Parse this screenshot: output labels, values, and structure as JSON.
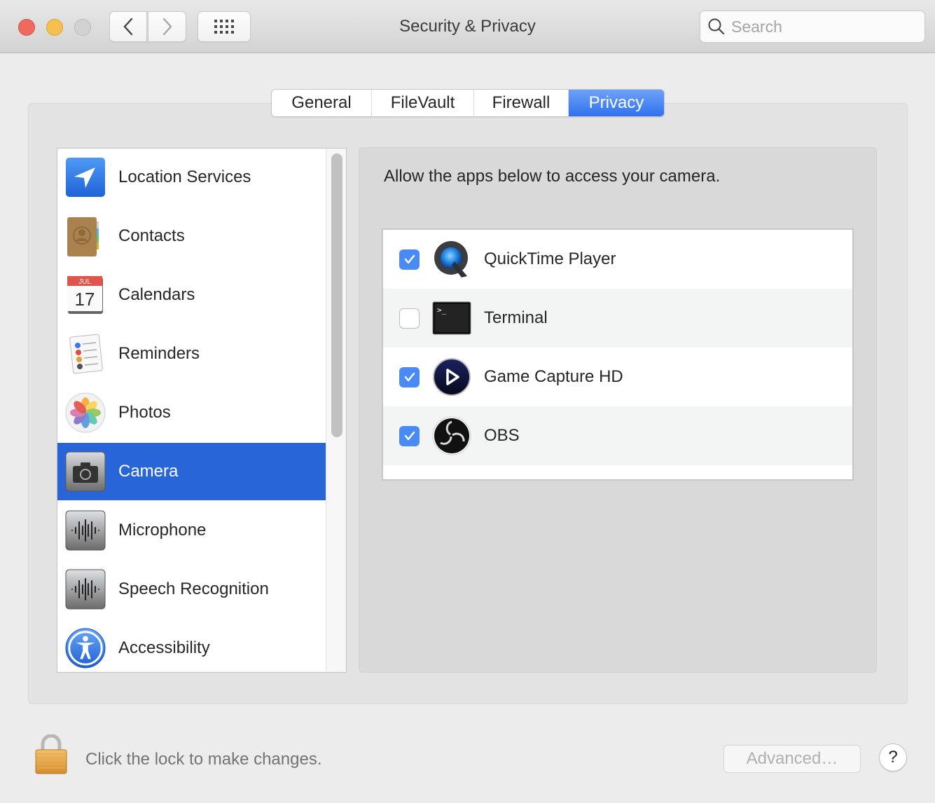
{
  "window": {
    "title": "Security & Privacy",
    "search": {
      "placeholder": "Search",
      "value": ""
    }
  },
  "tabs": [
    {
      "label": "General",
      "active": false
    },
    {
      "label": "FileVault",
      "active": false
    },
    {
      "label": "Firewall",
      "active": false
    },
    {
      "label": "Privacy",
      "active": true
    }
  ],
  "categories": [
    {
      "label": "Location Services",
      "icon": "location-icon",
      "selected": false
    },
    {
      "label": "Contacts",
      "icon": "contacts-icon",
      "selected": false
    },
    {
      "label": "Calendars",
      "icon": "calendar-icon",
      "selected": false,
      "icon_month": "JUL",
      "icon_day": "17"
    },
    {
      "label": "Reminders",
      "icon": "reminders-icon",
      "selected": false
    },
    {
      "label": "Photos",
      "icon": "photos-icon",
      "selected": false
    },
    {
      "label": "Camera",
      "icon": "camera-icon",
      "selected": true
    },
    {
      "label": "Microphone",
      "icon": "microphone-icon",
      "selected": false
    },
    {
      "label": "Speech Recognition",
      "icon": "speech-recognition-icon",
      "selected": false
    },
    {
      "label": "Accessibility",
      "icon": "accessibility-icon",
      "selected": false
    }
  ],
  "panel": {
    "instruction": "Allow the apps below to access your camera.",
    "apps": [
      {
        "label": "QuickTime Player",
        "icon": "quicktime-icon",
        "checked": true
      },
      {
        "label": "Terminal",
        "icon": "terminal-icon",
        "checked": false,
        "icon_text": ">_"
      },
      {
        "label": "Game Capture HD",
        "icon": "game-capture-icon",
        "checked": true
      },
      {
        "label": "OBS",
        "icon": "obs-icon",
        "checked": true
      }
    ]
  },
  "footer": {
    "lock_text": "Click the lock to make changes.",
    "advanced_label": "Advanced…",
    "help_label": "?"
  },
  "colors": {
    "accent": "#2765d8",
    "checkbox_on": "#4a8af4",
    "tab_active": "#2f72ef"
  }
}
